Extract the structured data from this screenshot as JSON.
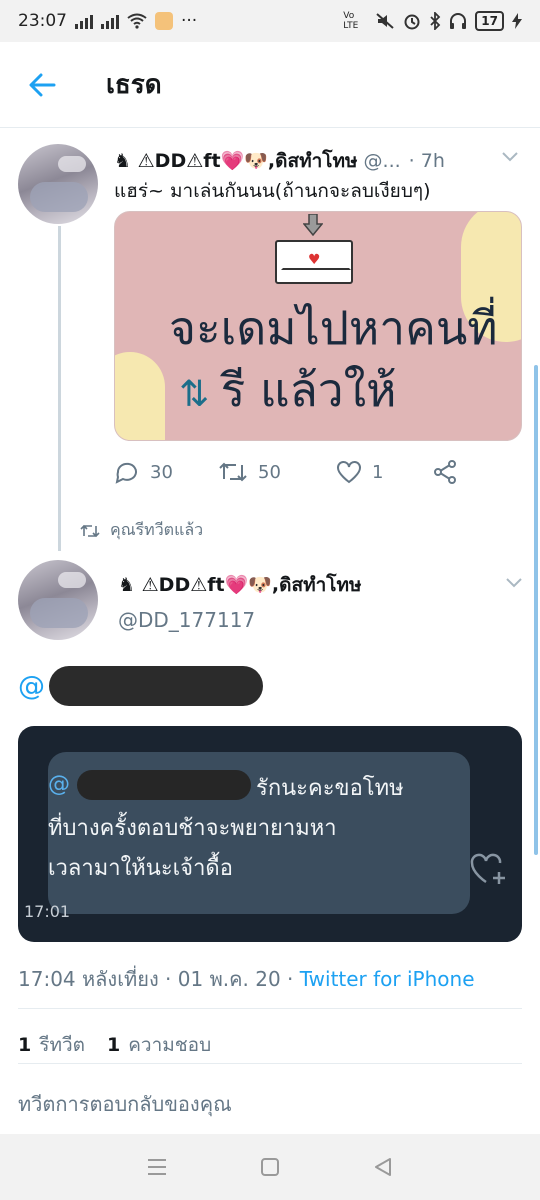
{
  "status_bar": {
    "time": "23:07",
    "more": "···",
    "network": "Vo LTE",
    "battery": "17"
  },
  "header": {
    "title": "เธรด"
  },
  "tweet1": {
    "display_name": "♞ ⚠DD⚠ft💗🐶,ดิสทำโทษ",
    "handle_truncated": "@...",
    "time": "· 7h",
    "text": "แฮร่~ มาเล่นกันนน(ถ้านกจะลบเงียบๆ)",
    "image_text_line1": "จะเดมไปหาคนที่",
    "image_text_line2": "รี แล้วให้",
    "replies": "30",
    "retweets": "50",
    "likes": "1"
  },
  "retweet_note": "คุณรีทวีตแล้ว",
  "tweet2": {
    "display_name": "♞ ⚠DD⚠ft💗🐶,ดิสทำโทษ",
    "handle": "@DD_177117",
    "mention_prefix": "@",
    "chat": {
      "mention_prefix": "@",
      "line1_rest": "รักนะคะขอโทษ",
      "line2": "ที่บางครั้งตอบช้าจะพยายามหา",
      "line3": "เวลามาให้นะเจ้าดื้อ",
      "time": "17:01"
    },
    "meta_time": "17:04 หลังเที่ยง · 01 พ.ค. 20 · ",
    "client": "Twitter for iPhone",
    "retweet_count": "1",
    "retweet_label": "รีทวีต",
    "like_count": "1",
    "like_label": "ความชอบ"
  },
  "reply_placeholder": "ทวีตการตอบกลับของคุณ",
  "colors": {
    "accent": "#1da1f2",
    "muted": "#657786",
    "chat_bg": "#1a2430",
    "bubble_bg": "#3b4d5e"
  }
}
